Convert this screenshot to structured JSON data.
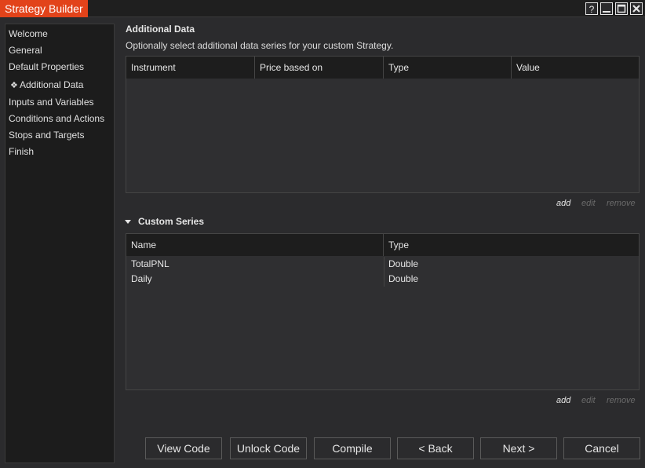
{
  "window": {
    "title": "Strategy Builder",
    "controls": [
      "help-icon",
      "minimize-icon",
      "maximize-icon",
      "close-icon"
    ],
    "accent_color": "#e2431a"
  },
  "sidebar": {
    "items": [
      {
        "label": "Welcome"
      },
      {
        "label": "General"
      },
      {
        "label": "Default Properties"
      },
      {
        "label": "Additional Data",
        "selected": true
      },
      {
        "label": "Inputs and Variables"
      },
      {
        "label": "Conditions and Actions"
      },
      {
        "label": "Stops and Targets"
      },
      {
        "label": "Finish"
      }
    ]
  },
  "additional_data": {
    "heading": "Additional Data",
    "description": "Optionally select additional data series for your custom Strategy.",
    "columns": [
      "Instrument",
      "Price based on",
      "Type",
      "Value"
    ],
    "rows": [],
    "actions": {
      "add": "add",
      "edit": "edit",
      "remove": "remove"
    }
  },
  "custom_series": {
    "heading": "Custom Series",
    "columns": [
      "Name",
      "Type"
    ],
    "rows": [
      {
        "name": "TotalPNL",
        "type": "Double"
      },
      {
        "name": "Daily",
        "type": "Double"
      }
    ],
    "actions": {
      "add": "add",
      "edit": "edit",
      "remove": "remove"
    }
  },
  "footer": {
    "view_code": "View Code",
    "unlock_code": "Unlock Code",
    "compile": "Compile",
    "back": "< Back",
    "next": "Next >",
    "cancel": "Cancel"
  }
}
